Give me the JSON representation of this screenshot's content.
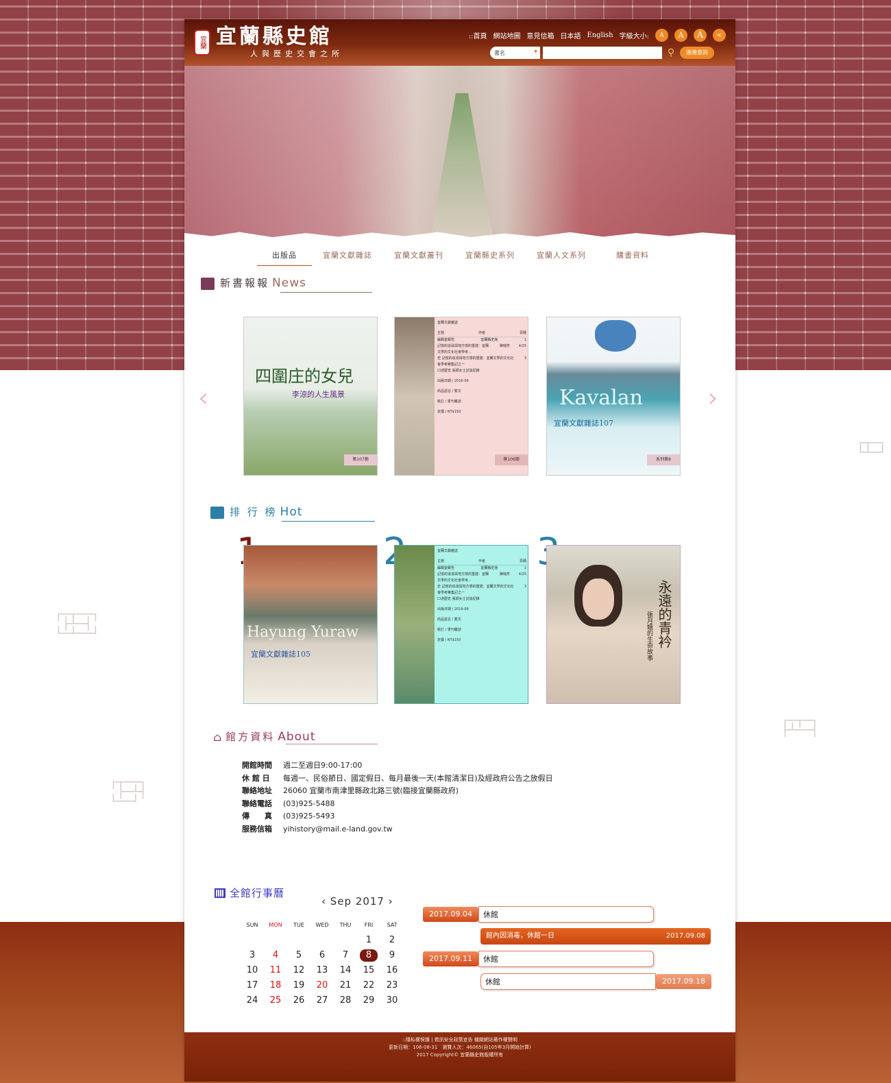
{
  "header": {
    "logo_title": "宜蘭縣史館",
    "logo_sub": "人與歷史交會之所",
    "seal_text": "宜蘭",
    "nav": [
      "::首頁",
      "網站地圖",
      "意見信箱",
      "日本語",
      "English",
      "字級大小:"
    ],
    "font_sizes": [
      "A",
      "A",
      "A"
    ],
    "search_select": "書名",
    "search_placeholder": "",
    "advanced_label": "進階查詢"
  },
  "tabs": [
    "出版品",
    "宜蘭文獻雜誌",
    "宜蘭文獻叢刊",
    "宜蘭縣史系列",
    "宜蘭人文系列",
    "購書資料"
  ],
  "news": {
    "title_zh": "新書報報",
    "title_en": "News",
    "items": [
      {
        "title": "四圍庄的女兒",
        "subtitle": "李涼的人生風景",
        "tag": "第107期"
      },
      {
        "title": "宜蘭文獻雜誌",
        "tag": "第106期"
      },
      {
        "title": "Kavalan",
        "subtitle": "宜蘭文獻雜誌107",
        "tag": "系列第8"
      }
    ],
    "detail": {
      "heading": "宜蘭文獻雜誌",
      "cols": [
        "主題",
        "作者",
        "頁碼"
      ],
      "rows": [
        [
          "編輯室報告",
          "宜蘭縣史館",
          "1"
        ],
        [
          "記憶的追尋與地方感的重建：宜蘭文學的文化社會學考...",
          "陳瑞芳",
          "4/25"
        ],
        [
          "史 記憶的追尋與地方感的重建：宜蘭文學的文化社會學考察集記之一",
          "",
          "3"
        ],
        [
          "口述歷史 張順女士訪談紀錄",
          "",
          ""
        ]
      ],
      "date": "出版日期 / 2016-06",
      "lang": "商品語言 / 繁文",
      "binding": "裝訂 / 季刊雜誌",
      "price": "定價 / NT$150"
    }
  },
  "hot": {
    "title_zh": "排 行 榜",
    "title_en": "Hot",
    "ranks": [
      "1",
      "2",
      "3"
    ],
    "items": [
      {
        "title": "Hayung Yuraw",
        "subtitle": "宜蘭文獻雜誌105"
      },
      {
        "title": "宜蘭文獻雜誌"
      },
      {
        "title": "永遠的青衿",
        "subtitle": "張月娥的生命故事"
      }
    ]
  },
  "about": {
    "title_zh": "館方資料",
    "title_en": "About",
    "rows": [
      {
        "label": "開館時間",
        "value": "週二至週日9:00-17:00"
      },
      {
        "label": "休 館 日",
        "value": "每週一、民俗節日、國定假日、每月最後一天(本館清潔日)及經政府公告之放假日"
      },
      {
        "label": "聯絡地址",
        "value": "26060 宜蘭市南津里縣政北路三號(臨接宜蘭縣政府)"
      },
      {
        "label": "聯絡電話",
        "value": "(03)925-5488"
      },
      {
        "label": "傳　　真",
        "value": "(03)925-5493"
      },
      {
        "label": "服務信箱",
        "value": "yihistory@mail.e-land.gov.tw"
      }
    ]
  },
  "calendar": {
    "title": "全館行事曆",
    "month_label": "‹ Sep 2017 ›",
    "weekdays": [
      "SUN",
      "MON",
      "TUE",
      "WED",
      "THU",
      "FRI",
      "SAT"
    ],
    "days": [
      "",
      "",
      "",
      "",
      "",
      "1",
      "2",
      "3",
      "4",
      "5",
      "6",
      "7",
      "8",
      "9",
      "10",
      "11",
      "12",
      "13",
      "14",
      "15",
      "16",
      "17",
      "18",
      "19",
      "20",
      "21",
      "22",
      "23",
      "24",
      "25",
      "26",
      "27",
      "28",
      "29",
      "30"
    ],
    "red_days": [
      "4",
      "11",
      "18",
      "20",
      "25"
    ],
    "today": "8",
    "events": [
      {
        "date": "2017.09.04",
        "text": "休館"
      },
      {
        "date": "2017.09.08",
        "text": "館內因消毒，休館一日"
      },
      {
        "date": "2017.09.11",
        "text": "休館"
      },
      {
        "date": "2017.09.18",
        "text": "休館"
      }
    ]
  },
  "footer": {
    "line1": "::隱私權保護 | 資訊安全政策宣告 機關網站著作權聲明",
    "line2": "更新日期：106-08-31　瀏覽人次：46065(自105年3月開始計算)",
    "line3": "2017 Copyright© 宜蘭縣史館版權所有"
  },
  "colors": {
    "brand": "#7f2a10",
    "accent": "#f08a25",
    "news": "#7a3a5a",
    "hot": "#2d7fa8",
    "about": "#9a3a5a",
    "calendar": "#3c3cbf"
  }
}
